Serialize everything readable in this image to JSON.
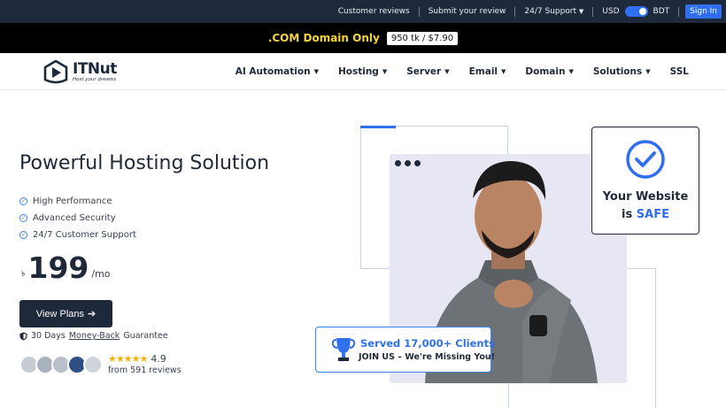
{
  "topbar": {
    "links": [
      "Customer reviews",
      "Submit your review",
      "24/7 Support"
    ],
    "currency_left": "USD",
    "currency_right": "BDT",
    "signin_label": "Sign In"
  },
  "promo": {
    "text": ".COM Domain Only",
    "price_badge": "950 tk / $7.90"
  },
  "brand": {
    "name": "ITNut",
    "tagline": "Host your dreams"
  },
  "nav": {
    "items": [
      "AI Automation",
      "Hosting",
      "Server",
      "Email",
      "Domain",
      "Solutions",
      "SSL"
    ]
  },
  "hero": {
    "title": "Powerful Hosting Solution",
    "features": [
      "High Performance",
      "Advanced Security",
      "24/7 Customer Support"
    ],
    "currency_symbol": "৳",
    "price": "199",
    "per": "/mo",
    "cta_label": "View Plans",
    "guarantee_pre": "30 Days ",
    "guarantee_link": "Money-Back",
    "guarantee_post": " Guarantee",
    "rating": "4.9",
    "rating_stars": 5,
    "reviews_text": "from 591 reviews"
  },
  "safe_card": {
    "line1": "Your Website",
    "line2_pre": "is ",
    "line2_highlight": "SAFE"
  },
  "clients": {
    "title": "Served 17,000+ Clients",
    "subtitle": "JOIN US – We're Missing You!"
  },
  "colors": {
    "dark": "#1e2a3b",
    "accent": "#2f6ff0",
    "promo_text": "#f5d53a",
    "star": "#f4b400"
  }
}
